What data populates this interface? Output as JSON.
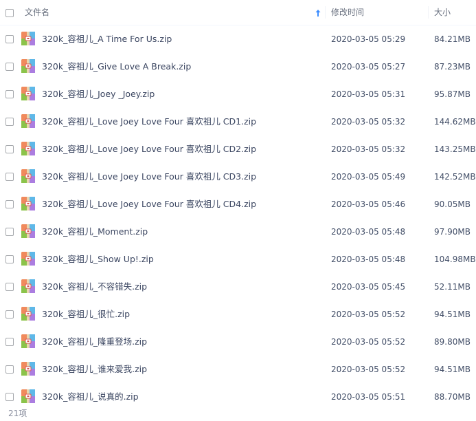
{
  "header": {
    "filename_label": "文件名",
    "modified_label": "修改时间",
    "size_label": "大小",
    "sort_icon": "arrow-up-icon",
    "accent_color": "#3b8cff"
  },
  "files": [
    {
      "name": "320k_容祖儿_A Time For Us.zip",
      "date": "2020-03-05 05:29",
      "size": "84.21MB"
    },
    {
      "name": "320k_容祖儿_Give Love A Break.zip",
      "date": "2020-03-05 05:27",
      "size": "87.23MB"
    },
    {
      "name": "320k_容祖儿_Joey _Joey.zip",
      "date": "2020-03-05 05:31",
      "size": "95.87MB"
    },
    {
      "name": "320k_容祖儿_Love Joey Love Four 喜欢祖儿 CD1.zip",
      "date": "2020-03-05 05:32",
      "size": "144.62MB"
    },
    {
      "name": "320k_容祖儿_Love Joey Love Four 喜欢祖儿 CD2.zip",
      "date": "2020-03-05 05:32",
      "size": "143.25MB"
    },
    {
      "name": "320k_容祖儿_Love Joey Love Four 喜欢祖儿 CD3.zip",
      "date": "2020-03-05 05:49",
      "size": "142.52MB"
    },
    {
      "name": "320k_容祖儿_Love Joey Love Four 喜欢祖儿 CD4.zip",
      "date": "2020-03-05 05:46",
      "size": "90.05MB"
    },
    {
      "name": "320k_容祖儿_Moment.zip",
      "date": "2020-03-05 05:48",
      "size": "97.90MB"
    },
    {
      "name": "320k_容祖儿_Show Up!.zip",
      "date": "2020-03-05 05:48",
      "size": "104.98MB"
    },
    {
      "name": "320k_容祖儿_不容错失.zip",
      "date": "2020-03-05 05:45",
      "size": "52.11MB"
    },
    {
      "name": "320k_容祖儿_很忙.zip",
      "date": "2020-03-05 05:52",
      "size": "94.51MB"
    },
    {
      "name": "320k_容祖儿_隆重登场.zip",
      "date": "2020-03-05 05:52",
      "size": "89.80MB"
    },
    {
      "name": "320k_容祖儿_谁来爱我.zip",
      "date": "2020-03-05 05:52",
      "size": "94.51MB"
    },
    {
      "name": "320k_容祖儿_说真的.zip",
      "date": "2020-03-05 05:51",
      "size": "88.70MB"
    }
  ],
  "file_icon": "zip-archive-icon",
  "footer": {
    "count_label": "21项"
  }
}
